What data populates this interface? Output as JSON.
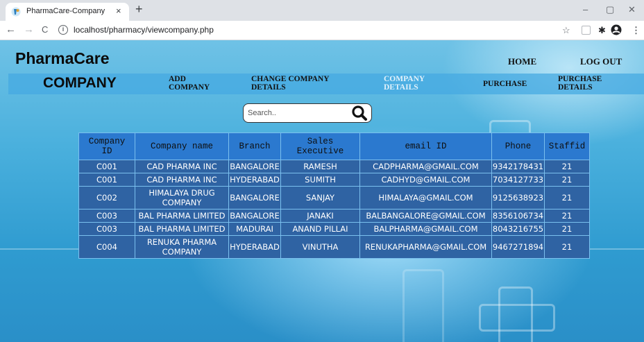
{
  "browser": {
    "tab_title": "PharmaCare-Company",
    "tab_close_glyph": "×",
    "new_tab_glyph": "+",
    "url": "localhost/pharmacy/viewcompany.php",
    "window_controls": [
      "–",
      "▢",
      "✕"
    ],
    "nav": {
      "back": "←",
      "forward": "→",
      "reload": "C"
    },
    "info_glyph": "i",
    "toolbar_icons": [
      "star-icon",
      "extension-icon",
      "puzzle-icon",
      "profile-icon",
      "menu-dots-icon"
    ]
  },
  "header": {
    "brand": "PharmaCare",
    "home": "HOME",
    "logout": "LOG OUT"
  },
  "menu": {
    "title": "COMPANY",
    "items": [
      {
        "label": "ADD COMPANY",
        "active": false
      },
      {
        "label": "CHANGE COMPANY DETAILS",
        "active": false
      },
      {
        "label": "COMPANY DETAILS",
        "active": true
      },
      {
        "label": "PURCHASE",
        "active": false
      },
      {
        "label": "PURCHASE DETAILS",
        "active": false
      }
    ]
  },
  "search": {
    "placeholder": "Search.."
  },
  "table": {
    "columns": [
      "Company ID",
      "Company name",
      "Branch",
      "Sales Executive",
      "email ID",
      "Phone",
      "Staffid"
    ],
    "rows": [
      [
        "C001",
        "CAD PHARMA INC",
        "BANGALORE",
        "RAMESH",
        "CADPHARMA@GMAIL.COM",
        "9342178431",
        "21"
      ],
      [
        "C001",
        "CAD PHARMA INC",
        "HYDERABAD",
        "SUMITH",
        "CADHYD@GMAIL.COM",
        "7034127733",
        "21"
      ],
      [
        "C002",
        "HIMALAYA DRUG COMPANY",
        "BANGALORE",
        "SANJAY",
        "HIMALAYA@GMAIL.COM",
        "9125638923",
        "21"
      ],
      [
        "C003",
        "BAL PHARMA LIMITED",
        "BANGALORE",
        "JANAKI",
        "BALBANGALORE@GMAIL.COM",
        "8356106734",
        "21"
      ],
      [
        "C003",
        "BAL PHARMA LIMITED",
        "MADURAI",
        "ANAND PILLAI",
        "BALPHARMA@GMAIL.COM",
        "8043216755",
        "21"
      ],
      [
        "C004",
        "RENUKA PHARMA COMPANY",
        "HYDERABAD",
        "VINUTHA",
        "RENUKAPHARMA@GMAIL.COM",
        "9467271894",
        "21"
      ]
    ]
  },
  "colors": {
    "header_cell": "#2b79cf",
    "body_cell": "#2f63a3",
    "cell_border": "#7bc0ee",
    "menubar": "#46aae1"
  }
}
